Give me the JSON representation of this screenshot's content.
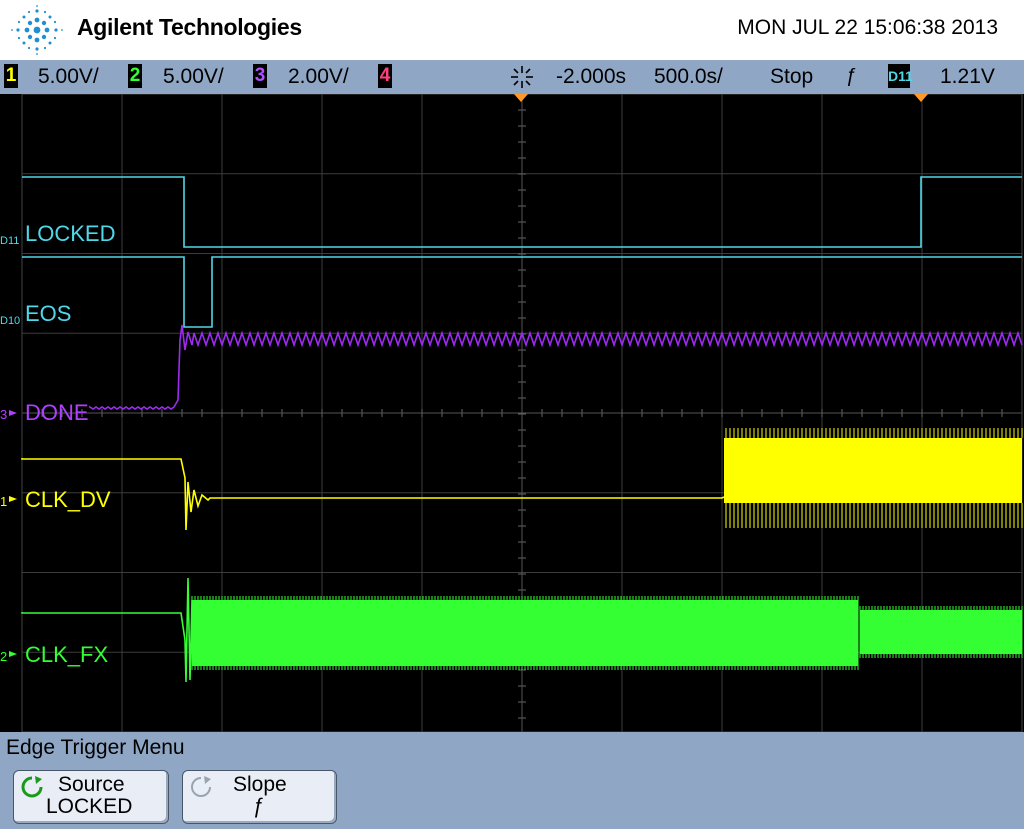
{
  "title_bar": {
    "brand": "Agilent Technologies",
    "datetime": "MON JUL 22 15:06:38 2013"
  },
  "status_bar": {
    "channels": [
      {
        "num": "1",
        "scale": "5.00V/",
        "color": "#ffff00"
      },
      {
        "num": "2",
        "scale": "5.00V/",
        "color": "#33ff33"
      },
      {
        "num": "3",
        "scale": "2.00V/",
        "color": "#b050ff"
      },
      {
        "num": "4",
        "scale": "",
        "color": "#ff4080"
      }
    ],
    "delay": "-2.000s",
    "timebase": "500.0s/",
    "run_state": "Stop",
    "trigger_slope_symbol": "ƒ",
    "trigger_source": "D11",
    "trigger_level": "1.21V"
  },
  "traces": {
    "locked": {
      "label": "LOCKED",
      "marker": "D11",
      "color": "#4fd8e8"
    },
    "eos": {
      "label": "EOS",
      "marker": "D10",
      "color": "#4fd8e8"
    },
    "done": {
      "label": "DONE",
      "marker": "3",
      "color": "#b040ff"
    },
    "clk_dv": {
      "label": "CLK_DV",
      "marker": "1",
      "color": "#ffff00"
    },
    "clk_fx": {
      "label": "CLK_FX",
      "marker": "2",
      "color": "#33ff33"
    }
  },
  "menu": {
    "title": "Edge Trigger Menu",
    "softkeys": [
      {
        "label": "Source",
        "value": "LOCKED",
        "icon": "rotate-knob-icon-active"
      },
      {
        "label": "Slope",
        "value": "ƒ",
        "icon": "rotate-knob-icon-inactive"
      }
    ]
  }
}
